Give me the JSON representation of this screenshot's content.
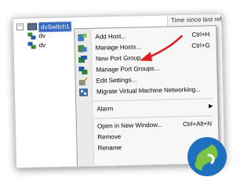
{
  "tree": {
    "expander": "−",
    "switch_label": "dvSwitch1",
    "child_labels": [
      "dv",
      "dv"
    ]
  },
  "right_pane": {
    "text": "Time since last refr"
  },
  "menu": {
    "items": [
      {
        "label": "Add Host...",
        "shortcut": "Ctrl+H",
        "icon": "add-host-icon",
        "color": "#3b7fc4"
      },
      {
        "label": "Manage Hosts...",
        "shortcut": "Ctrl+G",
        "icon": "manage-hosts-icon",
        "color": "#4a8a3c"
      },
      {
        "label": "New Port Group...",
        "shortcut": "",
        "icon": "new-port-group-icon",
        "color": "#2e7d32"
      },
      {
        "label": "Manage Port Groups...",
        "shortcut": "",
        "icon": "manage-port-groups-icon",
        "color": "#1e5aa8"
      },
      {
        "label": "Edit Settings...",
        "shortcut": "",
        "icon": "edit-settings-icon",
        "color": "#c98a1a"
      },
      {
        "label": "Migrate Virtual Machine Networking...",
        "shortcut": "",
        "icon": "migrate-vm-networking-icon",
        "color": "#3a6ea5"
      }
    ],
    "alarm": {
      "label": "Alarm",
      "arrow": "▶"
    },
    "open_new_window": {
      "label": "Open in New Window...",
      "shortcut": "Ctrl+Alt+N"
    },
    "remove": {
      "label": "Remove"
    },
    "rename": {
      "label": "Rename"
    }
  },
  "colors": {
    "annotation_arrow": "#e02020",
    "selection": "#3469c6",
    "logo_blue": "#1f6fbf",
    "logo_green": "#7cc243"
  }
}
